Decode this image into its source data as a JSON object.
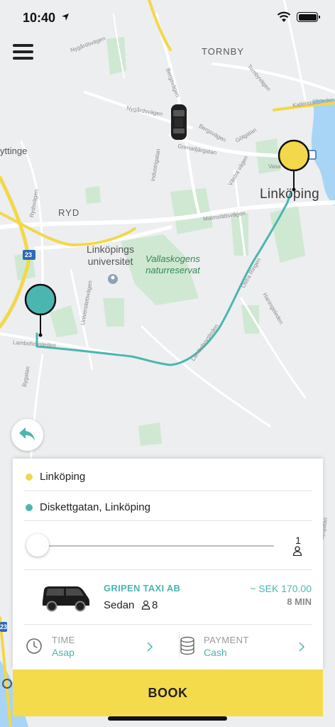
{
  "status_bar": {
    "time": "10:40"
  },
  "map": {
    "labels": {
      "tornby": "TORNBY",
      "ryd": "RYD",
      "yttinge": "yttinge",
      "linkoping": "Linköping",
      "university": [
        "Linköpings",
        "universitet"
      ],
      "park": [
        "Vallaskogens",
        "naturreservat"
      ],
      "road_23": "23",
      "road_23b": "23",
      "streets": {
        "nygardsvagen": "Nygårdsvägen",
        "nygardsvagen2": "Nygårdsvägen",
        "bergsvagen": "Bergsvägen",
        "bergsvagen2": "Bergsvägen",
        "tornbyvagen": "Tornbyvägen",
        "kallerstadsleden": "Kallerstadsleden",
        "industrigatan": "Industrigatan",
        "grenadjargatan": "Grenadjärgatan",
        "gotgatan": "Götgatan",
        "vastra_vagen": "Västra vägen",
        "vasa": "Vasa",
        "malmslattsvagen": "Malmslättsvägen",
        "rydsvagen": "Rydsvägen",
        "universitetsvagen": "Universitetsvägen",
        "lambohovsleden": "Lambohovsleden",
        "lambohovsleden2": "Lambohovsleden",
        "ostra_ringen": "Östra Ringen",
        "haningeleden": "Haningeleden",
        "bygatan": "Bygatan",
        "sjogatan": "Sjögatan"
      }
    }
  },
  "trip": {
    "destination": "Linköping",
    "pickup": "Diskettgatan, Linköping",
    "destination_color": "#f2d84a",
    "pickup_color": "#4bb6b0"
  },
  "passengers": {
    "count": "1",
    "value": 1
  },
  "vehicle": {
    "company": "GRIPEN TAXI AB",
    "type": "Sedan",
    "seats": "8",
    "price": "~ SEK 170.00",
    "eta": "8 MIN"
  },
  "options": {
    "time_title": "TIME",
    "time_value": "Asap",
    "payment_title": "PAYMENT",
    "payment_value": "Cash"
  },
  "book_label": "BOOK",
  "colors": {
    "accent": "#4bb6b0",
    "primary": "#f4db4b"
  }
}
